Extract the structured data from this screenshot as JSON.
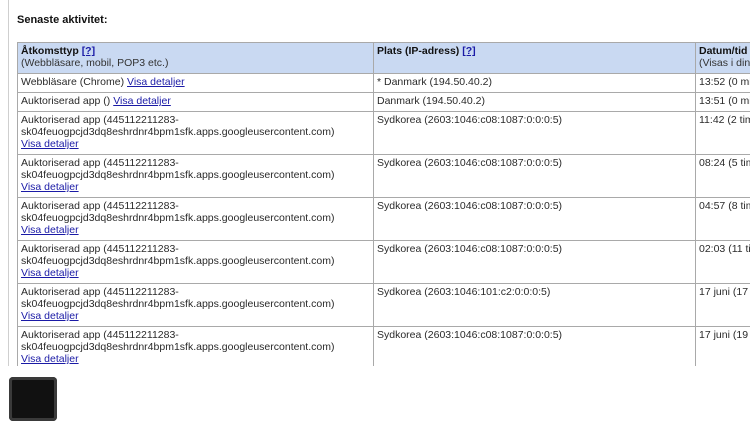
{
  "section_title": "Senaste aktivitet:",
  "headers": {
    "access_type": "Åtkomsttyp",
    "access_type_help": "[?]",
    "access_type_sub": "(Webbläsare, mobil, POP3 etc.)",
    "location": "Plats (IP-adress)",
    "location_help": "[?]",
    "datetime": "Datum/tid",
    "datetime_sub": "(Visas i din"
  },
  "rows": [
    {
      "type": "Webbläsare (Chrome)",
      "type2": "",
      "link": "Visa detaljer",
      "location": "* Danmark (194.50.40.2)",
      "time": "13:52 (0 mi"
    },
    {
      "type": "Auktoriserad app ()",
      "type2": "",
      "link": "Visa detaljer",
      "location": "Danmark (194.50.40.2)",
      "time": "13:51 (0 mi"
    },
    {
      "type": "Auktoriserad app (445112211283-",
      "type2": "sk04feuogpcjd3dq8eshrdnr4bpm1sfk.apps.googleusercontent.com)",
      "link": "Visa detaljer",
      "location": "Sydkorea (2603:1046:c08:1087:0:0:0:5)",
      "time": "11:42 (2 tim"
    },
    {
      "type": "Auktoriserad app (445112211283-",
      "type2": "sk04feuogpcjd3dq8eshrdnr4bpm1sfk.apps.googleusercontent.com)",
      "link": "Visa detaljer",
      "location": "Sydkorea (2603:1046:c08:1087:0:0:0:5)",
      "time": "08:24 (5 tim"
    },
    {
      "type": "Auktoriserad app (445112211283-",
      "type2": "sk04feuogpcjd3dq8eshrdnr4bpm1sfk.apps.googleusercontent.com)",
      "link": "Visa detaljer",
      "location": "Sydkorea (2603:1046:c08:1087:0:0:0:5)",
      "time": "04:57 (8 tim"
    },
    {
      "type": "Auktoriserad app (445112211283-",
      "type2": "sk04feuogpcjd3dq8eshrdnr4bpm1sfk.apps.googleusercontent.com)",
      "link": "Visa detaljer",
      "location": "Sydkorea (2603:1046:c08:1087:0:0:0:5)",
      "time": "02:03 (11 ti"
    },
    {
      "type": "Auktoriserad app (445112211283-",
      "type2": "sk04feuogpcjd3dq8eshrdnr4bpm1sfk.apps.googleusercontent.com)",
      "link": "Visa detaljer",
      "location": "Sydkorea (2603:1046:101:c2:0:0:0:5)",
      "time": "17 juni (17"
    },
    {
      "type": "Auktoriserad app (445112211283-",
      "type2": "sk04feuogpcjd3dq8eshrdnr4bpm1sfk.apps.googleusercontent.com)",
      "link": "Visa detaljer",
      "location": "Sydkorea (2603:1046:c08:1087:0:0:0:5)",
      "time": "17 juni (19"
    }
  ]
}
